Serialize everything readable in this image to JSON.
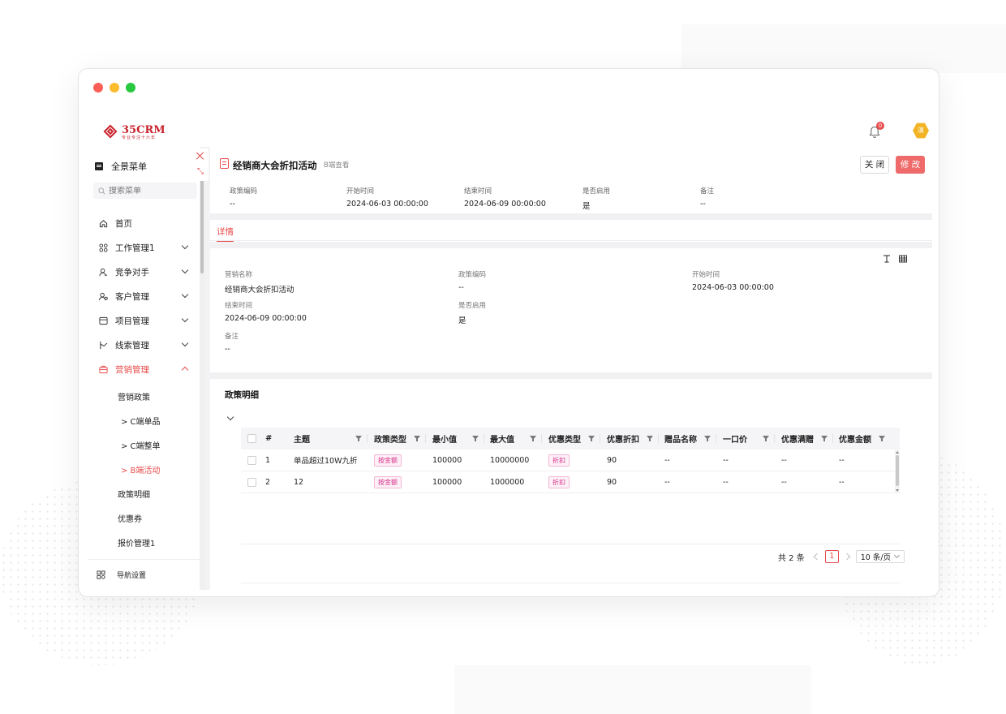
{
  "app": {
    "logo_text": "35CRM",
    "logo_sub": "专业专注十六年",
    "notification_count": "0",
    "avatar_text": "演"
  },
  "sidebar": {
    "all_menu": "全景菜单",
    "search_placeholder": "搜索菜单",
    "items": [
      {
        "label": "首页",
        "icon": "home-icon"
      },
      {
        "label": "工作管理1",
        "icon": "apps-icon"
      },
      {
        "label": "竞争对手",
        "icon": "user-icon"
      },
      {
        "label": "客户管理",
        "icon": "users-icon"
      },
      {
        "label": "项目管理",
        "icon": "folder-icon"
      },
      {
        "label": "线索管理",
        "icon": "clue-icon"
      },
      {
        "label": "营销管理",
        "icon": "briefcase-icon"
      }
    ],
    "sub_items": [
      {
        "label": "营销政策"
      },
      {
        "label": "> C端单品"
      },
      {
        "label": "> C端整单"
      },
      {
        "label": "> B端活动"
      },
      {
        "label": "政策明细"
      },
      {
        "label": "优惠券"
      },
      {
        "label": "报价管理1"
      }
    ],
    "footer_label": "导航设置"
  },
  "header": {
    "title": "经销商大会折扣活动",
    "tag": "B端查看",
    "close_label": "关 闭",
    "edit_label": "修 改"
  },
  "summary": [
    {
      "label": "政策编码",
      "value": "--"
    },
    {
      "label": "开始时间",
      "value": "2024-06-03 00:00:00"
    },
    {
      "label": "结束时间",
      "value": "2024-06-09 00:00:00"
    },
    {
      "label": "是否启用",
      "value": "是"
    },
    {
      "label": "备注",
      "value": "--"
    }
  ],
  "tabs": {
    "detail": "详情"
  },
  "detail": {
    "fields": [
      {
        "label": "营销名称",
        "value": "经销商大会折扣活动"
      },
      {
        "label": "政策编码",
        "value": "--"
      },
      {
        "label": "开始时间",
        "value": "2024-06-03 00:00:00"
      },
      {
        "label": "结束时间",
        "value": "2024-06-09 00:00:00"
      },
      {
        "label": "是否启用",
        "value": "是"
      },
      {
        "label": "备注",
        "value": "--"
      }
    ]
  },
  "policy": {
    "section_title": "政策明细",
    "columns": [
      "#",
      "主题",
      "政策类型",
      "最小值",
      "最大值",
      "优惠类型",
      "优惠折扣",
      "赠品名称",
      "一口价",
      "优惠满赠",
      "优惠金额"
    ],
    "rows": [
      {
        "no": "1",
        "subject": "单品超过10W九折",
        "policy_type": "按金额",
        "min": "100000",
        "max": "10000000",
        "discount_type": "折扣",
        "discount": "90",
        "gift": "--",
        "fixed_price": "--",
        "full_gift": "--",
        "amount": "--"
      },
      {
        "no": "2",
        "subject": "12",
        "policy_type": "按金额",
        "min": "100000",
        "max": "1000000",
        "discount_type": "折扣",
        "discount": "90",
        "gift": "--",
        "fixed_price": "--",
        "full_gift": "--",
        "amount": "--"
      }
    ]
  },
  "pagination": {
    "total": "共 2 条",
    "current_page": "1",
    "page_size": "10 条/页"
  },
  "colors": {
    "accent": "#e84b4b",
    "edit_button": "#ef6a6a",
    "tag_pink": "#d62f8a"
  }
}
